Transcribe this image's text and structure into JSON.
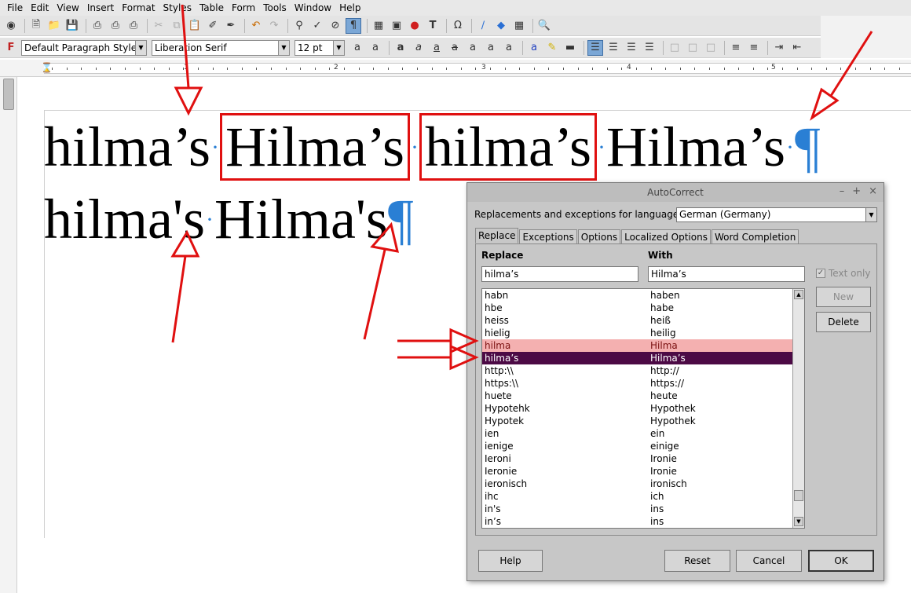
{
  "menu": [
    "File",
    "Edit",
    "View",
    "Insert",
    "Format",
    "Styles",
    "Table",
    "Form",
    "Tools",
    "Window",
    "Help"
  ],
  "format_bar": {
    "paragraph_style": "Default Paragraph Style",
    "font_name": "Liberation Serif",
    "font_size": "12 pt"
  },
  "ruler": {
    "numbers": [
      "1",
      "2",
      "3",
      "4",
      "5"
    ]
  },
  "document": {
    "line1": {
      "w1": "hilma’s",
      "w2": "Hilma’s",
      "w3": "hilma’s",
      "w4": "Hilma’s",
      "end": "¶"
    },
    "line2": {
      "w1": "hilma's",
      "w2": "Hilma's",
      "end": "¶"
    },
    "dot": "·"
  },
  "dialog": {
    "title": "AutoCorrect",
    "controls": [
      "–",
      "+",
      "×"
    ],
    "language_label": "Replacements and exceptions for language:",
    "language_value": "German (Germany)",
    "tabs": [
      "Replace",
      "Exceptions",
      "Options",
      "Localized Options",
      "Word Completion"
    ],
    "replace_header": "Replace",
    "with_header": "With",
    "replace_value": "hilma’s",
    "with_value": "Hilma’s",
    "text_only_label": "Text only",
    "new_button": "New",
    "delete_button": "Delete",
    "rows": [
      {
        "replace": "habn",
        "with": "haben"
      },
      {
        "replace": "hbe",
        "with": "habe"
      },
      {
        "replace": "heiss",
        "with": "heiß"
      },
      {
        "replace": "hielig",
        "with": "heilig"
      },
      {
        "replace": "hilma",
        "with": "Hilma"
      },
      {
        "replace": "hilma’s",
        "with": "Hilma’s"
      },
      {
        "replace": "http:\\\\",
        "with": "http://"
      },
      {
        "replace": "https:\\\\",
        "with": "https://"
      },
      {
        "replace": "huete",
        "with": "heute"
      },
      {
        "replace": "Hypotehk",
        "with": "Hypothek"
      },
      {
        "replace": "Hypotek",
        "with": "Hypothek"
      },
      {
        "replace": "ien",
        "with": "ein"
      },
      {
        "replace": "ienige",
        "with": "einige"
      },
      {
        "replace": "Ieroni",
        "with": "Ironie"
      },
      {
        "replace": "Ieronie",
        "with": "Ironie"
      },
      {
        "replace": "ieronisch",
        "with": "ironisch"
      },
      {
        "replace": "ihc",
        "with": "ich"
      },
      {
        "replace": "in's",
        "with": "ins"
      },
      {
        "replace": "in’s",
        "with": "ins"
      }
    ],
    "help_button": "Help",
    "reset_button": "Reset",
    "cancel_button": "Cancel",
    "ok_button": "OK"
  },
  "colors": {
    "annotation_red": "#e01010",
    "formatting_mark_blue": "#2a7fd4",
    "selected_row_dark": "#4c0a45",
    "selected_row_pink": "#f4b0b0"
  }
}
